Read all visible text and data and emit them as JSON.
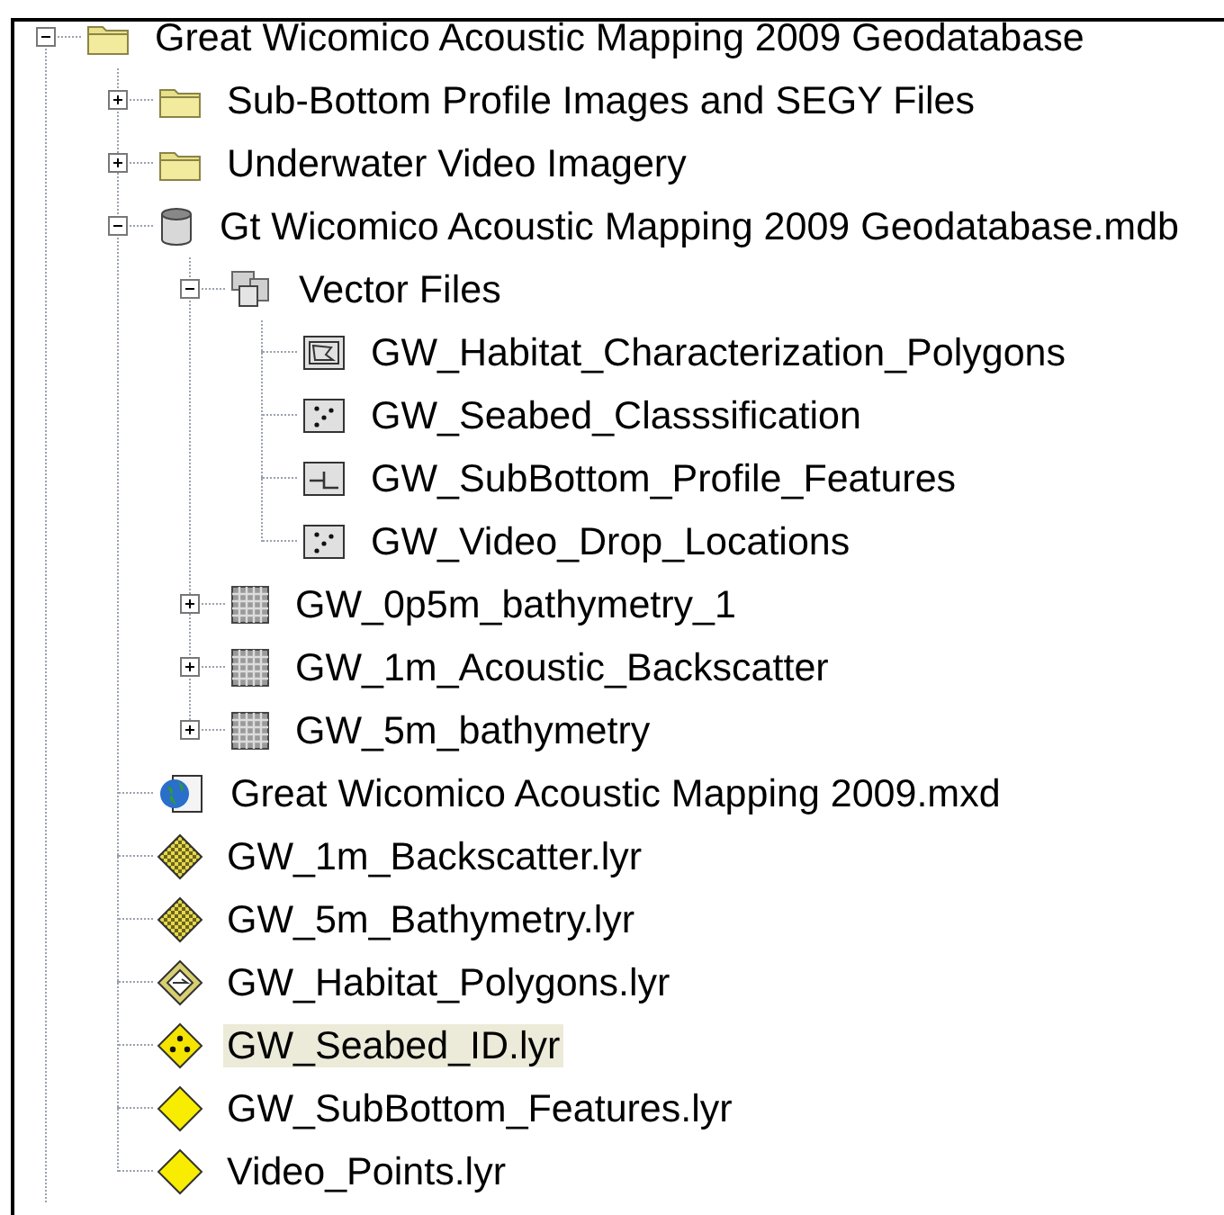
{
  "tree": [
    {
      "label": "Great Wicomico Acoustic Mapping 2009 Geodatabase",
      "kind": "folder",
      "expanded": true,
      "selected": false,
      "children": [
        {
          "label": "Sub-Bottom Profile Images and SEGY Files",
          "kind": "folder",
          "expanded": false,
          "selected": false
        },
        {
          "label": "Underwater Video Imagery",
          "kind": "folder",
          "expanded": false,
          "selected": false
        },
        {
          "label": "Gt Wicomico Acoustic Mapping 2009 Geodatabase.mdb",
          "kind": "database",
          "expanded": true,
          "selected": false,
          "children": [
            {
              "label": "Vector Files",
              "kind": "dataset",
              "expanded": true,
              "selected": false,
              "children": [
                {
                  "label": "GW_Habitat_Characterization_Polygons",
                  "kind": "polygons",
                  "selected": false
                },
                {
                  "label": "GW_Seabed_Classsification",
                  "kind": "points",
                  "selected": false
                },
                {
                  "label": "GW_SubBottom_Profile_Features",
                  "kind": "lines",
                  "selected": false
                },
                {
                  "label": "GW_Video_Drop_Locations",
                  "kind": "points",
                  "selected": false
                }
              ]
            },
            {
              "label": "GW_0p5m_bathymetry_1",
              "kind": "raster",
              "expanded": false,
              "selected": false
            },
            {
              "label": "GW_1m_Acoustic_Backscatter",
              "kind": "raster",
              "expanded": false,
              "selected": false
            },
            {
              "label": "GW_5m_bathymetry",
              "kind": "raster",
              "expanded": false,
              "selected": false
            }
          ]
        },
        {
          "label": "Great Wicomico Acoustic Mapping 2009.mxd",
          "kind": "map",
          "selected": false
        },
        {
          "label": "GW_1m_Backscatter.lyr",
          "kind": "raster_layer",
          "selected": false
        },
        {
          "label": "GW_5m_Bathymetry.lyr",
          "kind": "raster_layer",
          "selected": false
        },
        {
          "label": "GW_Habitat_Polygons.lyr",
          "kind": "polygon_layer",
          "selected": false
        },
        {
          "label": "GW_Seabed_ID.lyr",
          "kind": "point_layer",
          "selected": true
        },
        {
          "label": "GW_SubBottom_Features.lyr",
          "kind": "layer",
          "selected": false
        },
        {
          "label": "Video_Points.lyr",
          "kind": "layer",
          "selected": false
        }
      ]
    }
  ]
}
